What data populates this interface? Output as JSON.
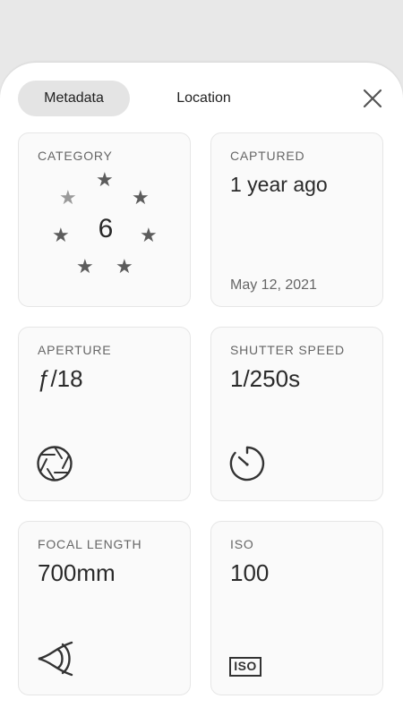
{
  "tabs": {
    "metadata": "Metadata",
    "location": "Location"
  },
  "category": {
    "label": "CATEGORY",
    "value": "6",
    "stars_total": 7,
    "stars_dim": 1
  },
  "captured": {
    "label": "CAPTURED",
    "value": "1 year ago",
    "date": "May 12, 2021"
  },
  "aperture": {
    "label": "APERTURE",
    "value": "ƒ/18"
  },
  "shutter": {
    "label": "SHUTTER SPEED",
    "value": "1/250s"
  },
  "focal": {
    "label": "FOCAL LENGTH",
    "value": "700mm"
  },
  "iso": {
    "label": "ISO",
    "value": "100",
    "badge": "ISO"
  },
  "colors": {
    "background": "#e8e8e8",
    "sheet": "#ffffff",
    "card": "#fafafa",
    "tab_active": "#e4e4e4",
    "text": "#2a2a2a"
  },
  "icons": [
    "close-icon",
    "star-icon",
    "aperture-icon",
    "timer-icon",
    "eye-icon",
    "iso-icon"
  ]
}
